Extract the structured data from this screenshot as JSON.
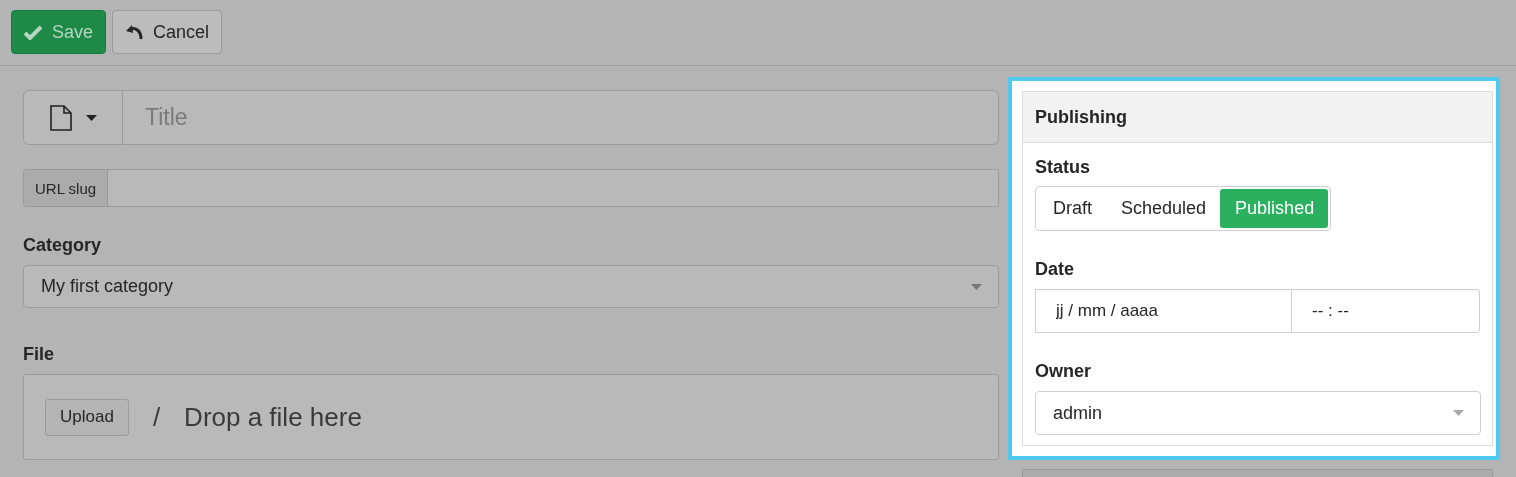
{
  "toolbar": {
    "buttons": [
      {
        "kind": "primary",
        "label": "Save"
      },
      {
        "kind": "default",
        "label": "Cancel"
      }
    ]
  },
  "title_field": {
    "placeholder": "Title"
  },
  "url_slug": {
    "label": "URL slug"
  },
  "category": {
    "label": "Category",
    "value": "My first category"
  },
  "file": {
    "label": "File",
    "upload_button": "Upload",
    "separator": "/",
    "drop_text": "Drop a file here"
  },
  "publishing": {
    "title": "Publishing",
    "status": {
      "label": "Status",
      "options": [
        {
          "label": "Draft",
          "selected": false
        },
        {
          "label": "Scheduled",
          "selected": false
        },
        {
          "label": "Published",
          "selected": true
        }
      ]
    },
    "date": {
      "label": "Date",
      "date_placeholder": "jj / mm / aaaa",
      "time_placeholder": "-- : --"
    },
    "owner": {
      "label": "Owner",
      "value": "admin"
    }
  }
}
